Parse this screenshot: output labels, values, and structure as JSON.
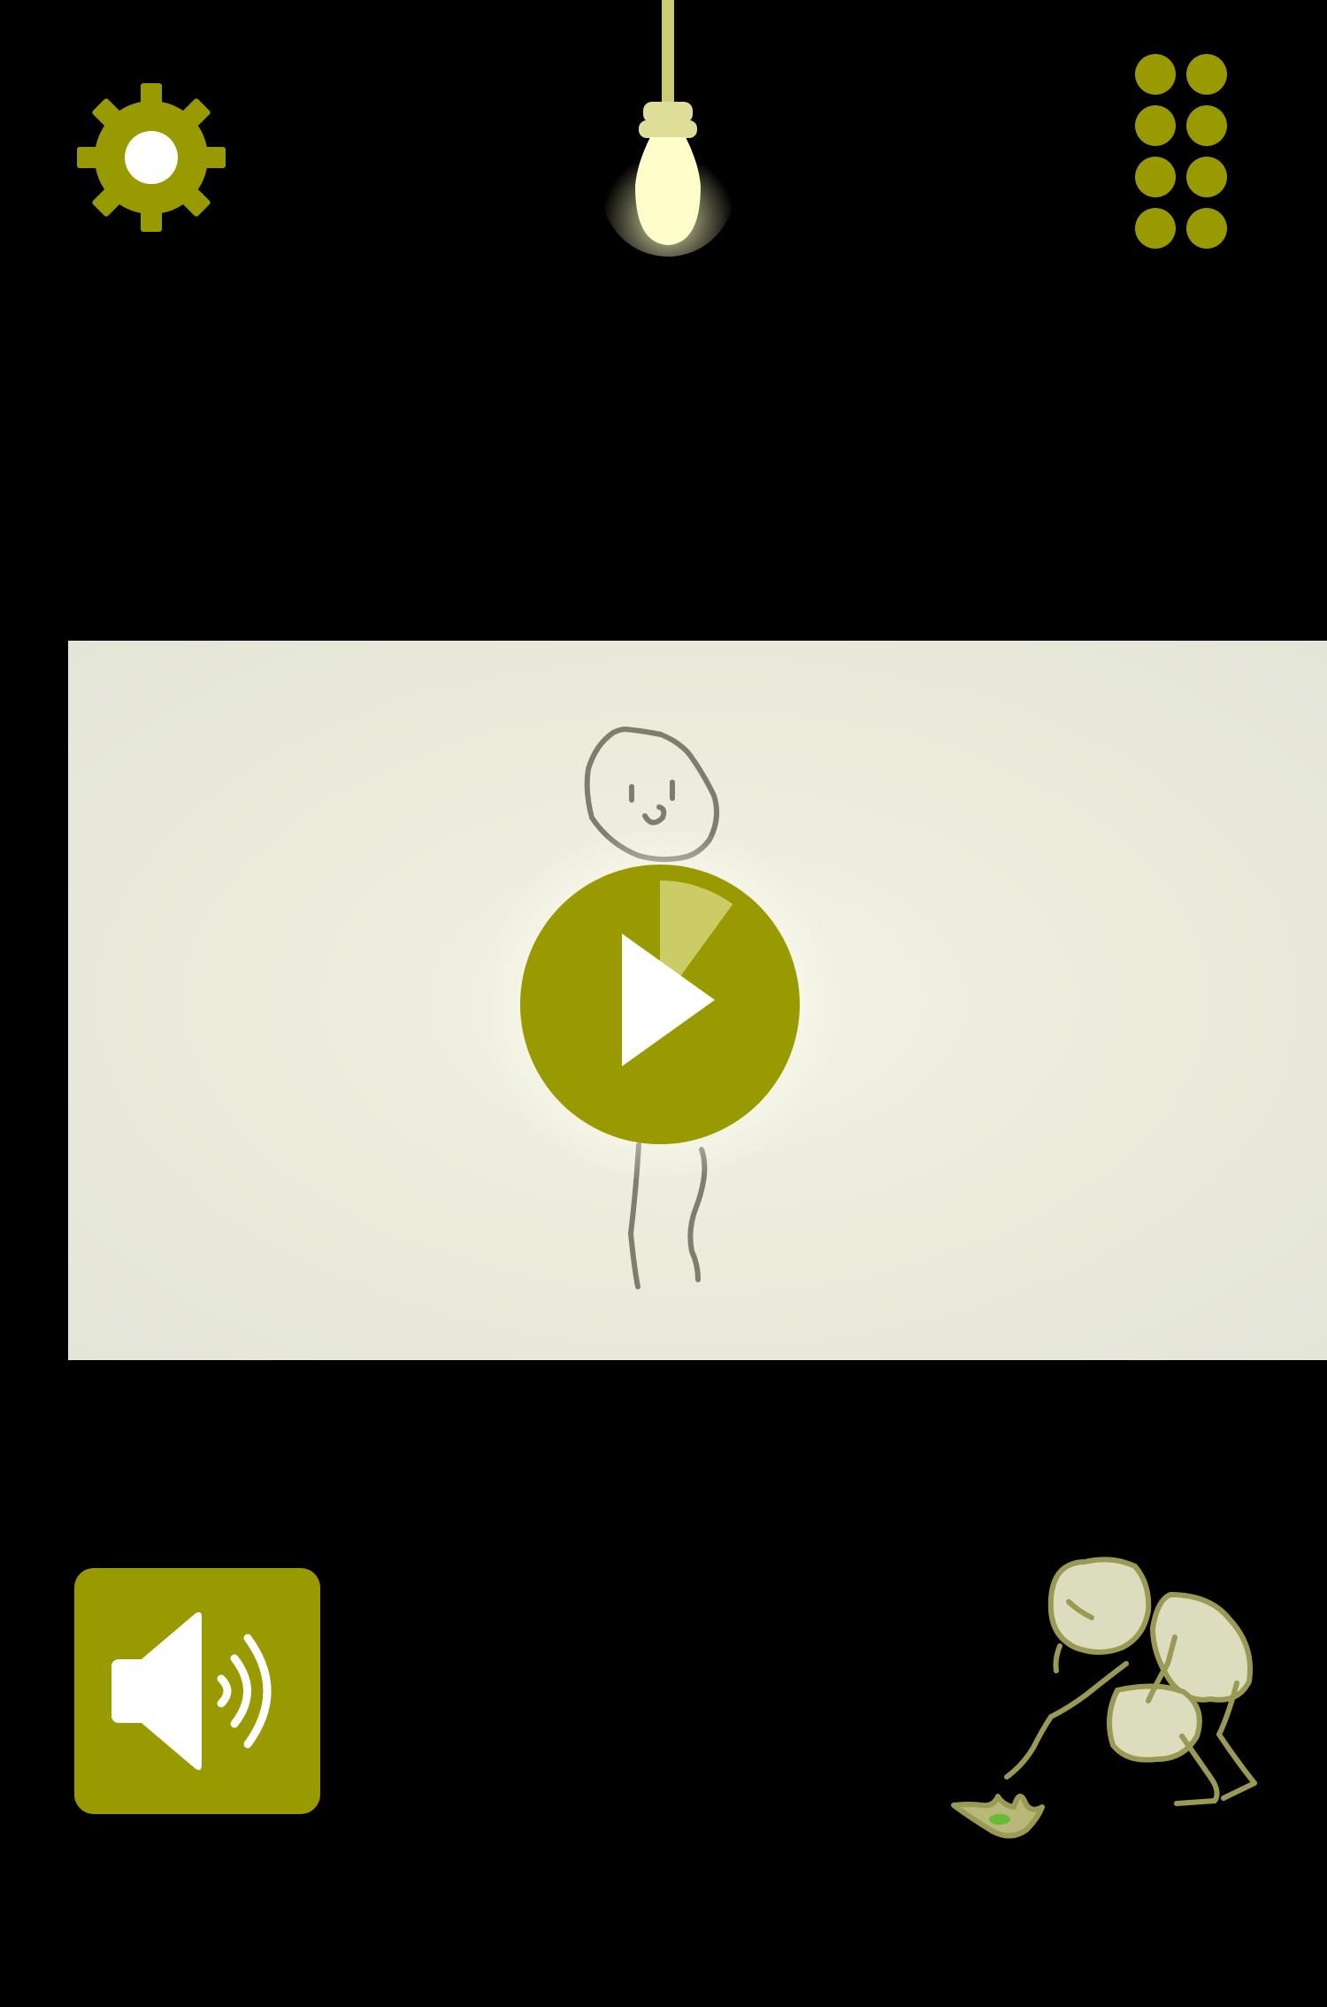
{
  "colors": {
    "background": "#000000",
    "accent": "#999900",
    "accent_light": "#cccc66",
    "bulb_glow": "#ffffc8",
    "scene_bg": "#ecece0",
    "doodle_stroke": "#7d7d70",
    "character_fill": "#dcdcbe",
    "character_stroke": "#9a9a55"
  },
  "icons": {
    "settings": "gear-icon",
    "menu": "grid-dots-icon",
    "light": "light-bulb-icon",
    "play": "play-icon",
    "sound": "speaker-icon",
    "progress": "progress-pie-icon"
  },
  "play_progress": 0.1
}
